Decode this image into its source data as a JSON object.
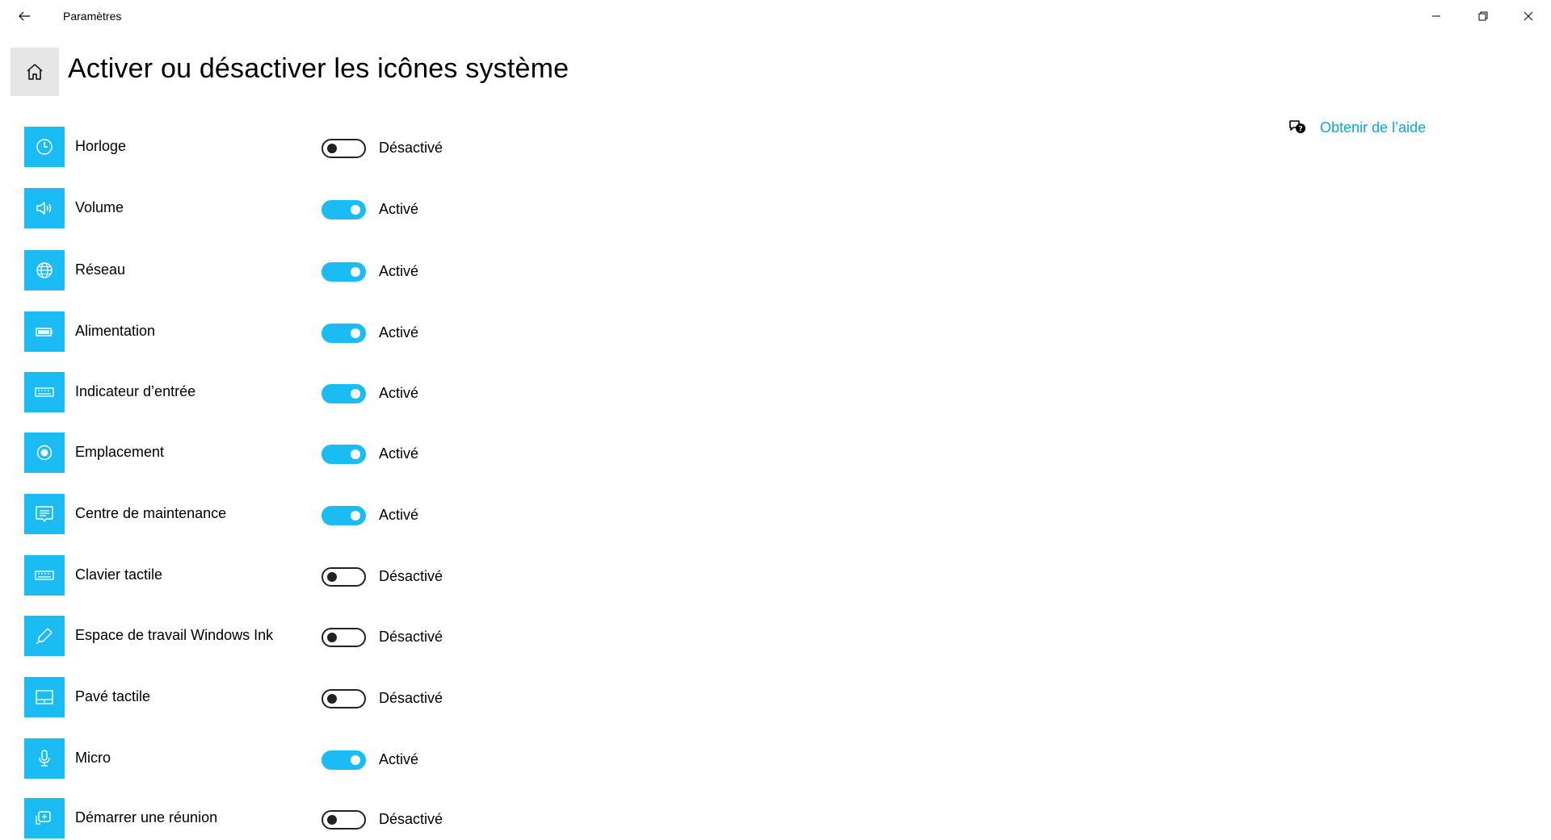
{
  "window": {
    "app_title": "Paramètres",
    "controls": {
      "minimize_icon": "minimize-icon",
      "maximize_icon": "restore-icon",
      "close_icon": "close-icon"
    }
  },
  "header": {
    "title": "Activer ou désactiver les icônes système",
    "home_icon": "home-icon",
    "back_icon": "back-arrow-icon"
  },
  "help": {
    "label": "Obtenir de l’aide",
    "icon": "chat-help-icon"
  },
  "colors": {
    "accent": "#1bbcf3",
    "link": "#0ea5d9",
    "home_bg": "#e6e6e6"
  },
  "rows": [
    {
      "label": "Horloge",
      "icon": "clock-icon",
      "on": false,
      "state": "Désactivé"
    },
    {
      "label": "Volume",
      "icon": "speaker-icon",
      "on": true,
      "state": "Activé"
    },
    {
      "label": "Réseau",
      "icon": "globe-icon",
      "on": true,
      "state": "Activé"
    },
    {
      "label": "Alimentation",
      "icon": "battery-icon",
      "on": true,
      "state": "Activé"
    },
    {
      "label": "Indicateur d’entrée",
      "icon": "keyboard-icon",
      "on": true,
      "state": "Activé"
    },
    {
      "label": "Emplacement",
      "icon": "location-icon",
      "on": true,
      "state": "Activé"
    },
    {
      "label": "Centre de maintenance",
      "icon": "action-center-icon",
      "on": true,
      "state": "Activé"
    },
    {
      "label": "Clavier tactile",
      "icon": "touch-keyboard-icon",
      "on": false,
      "state": "Désactivé"
    },
    {
      "label": "Espace de travail Windows Ink",
      "icon": "pen-icon",
      "on": false,
      "state": "Désactivé"
    },
    {
      "label": "Pavé tactile",
      "icon": "touchpad-icon",
      "on": false,
      "state": "Désactivé"
    },
    {
      "label": "Micro",
      "icon": "microphone-icon",
      "on": true,
      "state": "Activé"
    },
    {
      "label": "Démarrer une réunion",
      "icon": "meet-now-icon",
      "on": false,
      "state": "Désactivé"
    }
  ]
}
